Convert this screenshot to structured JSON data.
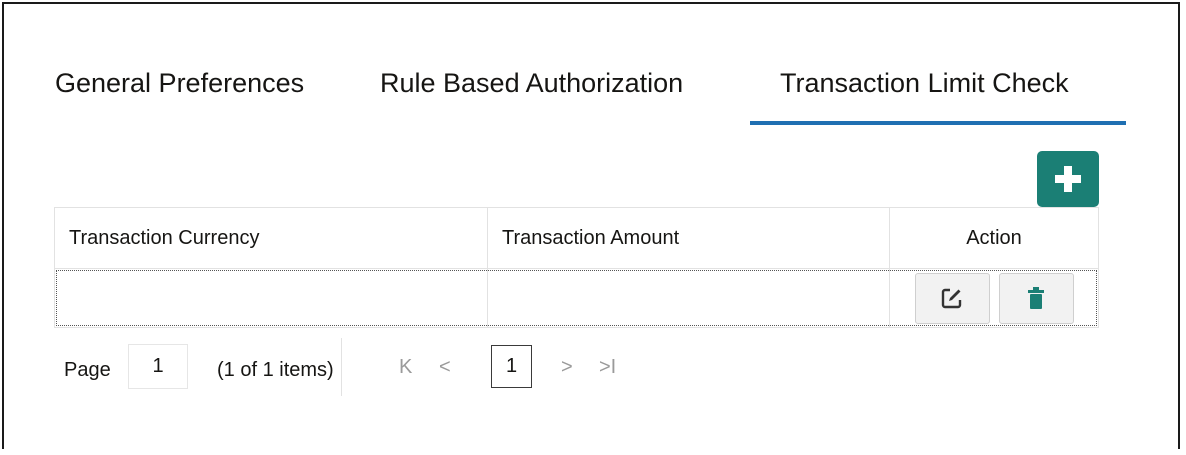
{
  "tabs": [
    {
      "label": "General Preferences",
      "selected": false
    },
    {
      "label": "Rule Based Authorization",
      "selected": false
    },
    {
      "label": "Transaction Limit Check",
      "selected": true
    }
  ],
  "colors": {
    "accent": "#1f6fb2",
    "add_button": "#1b7f75"
  },
  "toolbar": {
    "add_icon": "plus-icon"
  },
  "table": {
    "columns": [
      "Transaction Currency",
      "Transaction Amount",
      "Action"
    ],
    "rows": [
      {
        "currency": "",
        "amount": "",
        "actions": [
          "edit-icon",
          "trash-icon"
        ]
      }
    ]
  },
  "pagination": {
    "page_label": "Page",
    "page_value": "1",
    "items_text": "(1 of 1 items)",
    "first": "K",
    "prev": "<",
    "current_page": "1",
    "next": ">",
    "last": ">I"
  }
}
